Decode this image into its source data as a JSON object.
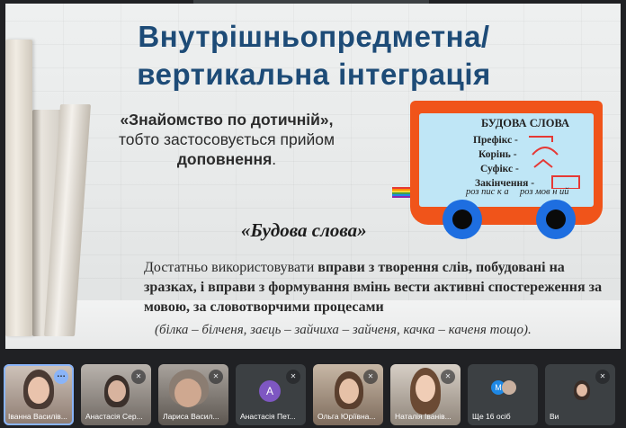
{
  "slide": {
    "title_line1": "Внутрішньопредметна/",
    "title_line2": "вертикальна  інтеграція",
    "intro_line1": "«Знайомство по дотичній»,",
    "intro_line2": "тобто застосовується прийом",
    "intro_line3": "доповнення",
    "intro_line3_end": ".",
    "wagon": {
      "heading": "БУДОВА СЛОВА",
      "parts": [
        "Префікс -",
        "Корінь -",
        "Суфікс -",
        "Закінчення -"
      ],
      "words": [
        "роз пис к а",
        "роз мов н ий"
      ]
    },
    "topic": "«Будова слова»",
    "para_start": "Достатньо використовувати ",
    "para_bold": "вправи з творення слів, побудовані на зразках, і вправи з формування вмінь вести активні спостереження за мовою, за словотворчими процесами",
    "examples": "(білка – білченя, заєць – зайчиха – зайченя, качка – каченя тощо)."
  },
  "participants": [
    {
      "name": "Іванна Василів",
      "label": "Іванна Василів..."
    },
    {
      "name": "Анастасія Сер...",
      "label": "Анастасія Сер..."
    },
    {
      "name": "Лариса Васил...",
      "label": "Лариса Васил..."
    },
    {
      "name": "Анастасія Пет...",
      "label": "Анастасія Пет...",
      "avatar_letter": "A"
    },
    {
      "name": "Ольга Юріївна...",
      "label": "Ольга Юріївна..."
    },
    {
      "name": "Наталія Іванів...",
      "label": "Наталія Іванів..."
    },
    {
      "name": "Ще 16 осіб",
      "label": "Ще 16 осіб",
      "avatar_letter": "M"
    },
    {
      "name": "Ви",
      "label": "Ви"
    }
  ],
  "icons": {
    "muted_mic": "mic-off-icon",
    "more_options": "more-options-icon"
  },
  "colors": {
    "title": "#1d4b77",
    "wagon": "#f0541a",
    "wagon_panel": "#bfe6f6",
    "wheel": "#1e6ee0",
    "active_tile": "#8ab4f8"
  }
}
